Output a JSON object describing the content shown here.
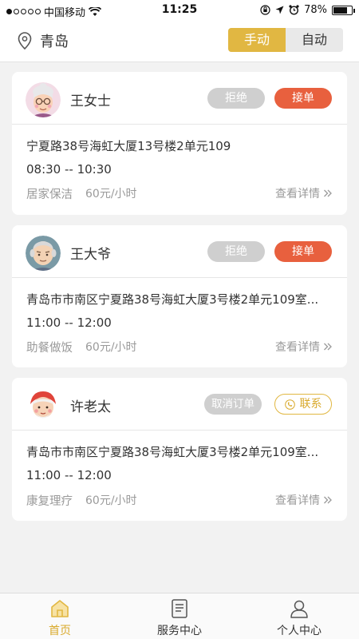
{
  "status_bar": {
    "carrier": "中国移动",
    "time": "11:25",
    "battery": "78%",
    "battery_level": 0.78
  },
  "header": {
    "city": "青岛",
    "mode_manual": "手动",
    "mode_auto": "自动"
  },
  "orders": [
    {
      "name": "王女士",
      "address": "宁夏路38号海虹大厦13号楼2单元109",
      "time": "08:30 -- 10:30",
      "service": "居家保洁",
      "price": "60元/小时",
      "detail": "查看详情",
      "btn_left": "拒绝",
      "btn_right": "接单"
    },
    {
      "name": "王大爷",
      "address": "青岛市市南区宁夏路38号海虹大厦3号楼2单元109室...",
      "time": "11:00 -- 12:00",
      "service": "助餐做饭",
      "price": "60元/小时",
      "detail": "查看详情",
      "btn_left": "拒绝",
      "btn_right": "接单"
    },
    {
      "name": "许老太",
      "address": "青岛市市南区宁夏路38号海虹大厦3号楼2单元109室...",
      "time": "11:00 -- 12:00",
      "service": "康复理疗",
      "price": "60元/小时",
      "detail": "查看详情",
      "btn_left": "取消订单",
      "btn_right": "联系"
    }
  ],
  "tabbar": {
    "home": "首页",
    "service": "服务中心",
    "profile": "个人中心"
  },
  "colors": {
    "accent": "#e1b742",
    "accept": "#e8603e",
    "disabled": "#cfcfcf"
  }
}
